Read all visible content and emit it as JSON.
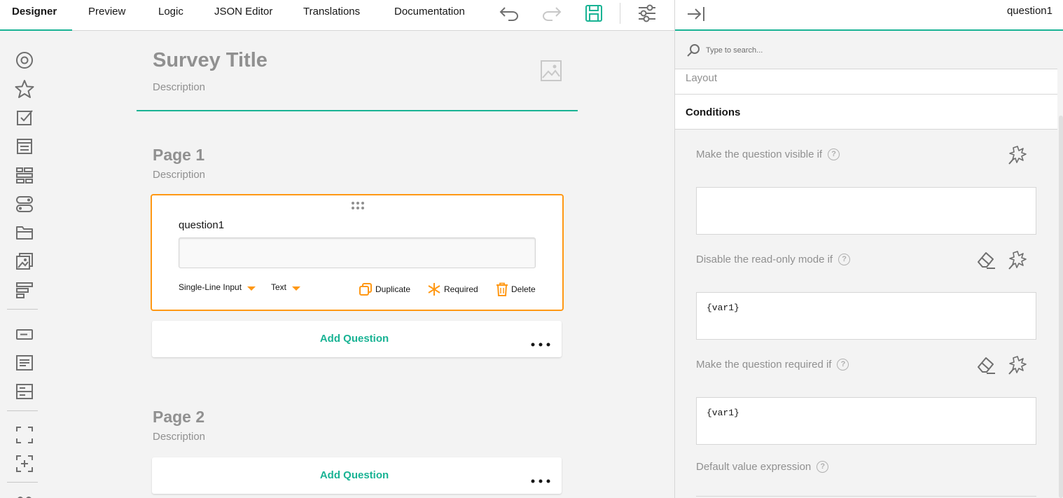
{
  "tabs": [
    {
      "label": "Designer"
    },
    {
      "label": "Preview"
    },
    {
      "label": "Logic"
    },
    {
      "label": "JSON Editor"
    },
    {
      "label": "Translations"
    },
    {
      "label": "Documentation"
    }
  ],
  "toolbar": {
    "undo_icon": "undo-icon",
    "redo_icon": "redo-icon",
    "save_icon": "save-icon",
    "settings_icon": "settings-icon"
  },
  "colors": {
    "accent": "#19b394",
    "selection": "#ff9814",
    "muted_text": "#909090"
  },
  "survey": {
    "title": "Survey Title",
    "description": "Description"
  },
  "pages": [
    {
      "title": "Page 1",
      "description": "Description"
    },
    {
      "title": "Page 2",
      "description": "Description"
    }
  ],
  "question": {
    "name": "question1",
    "type_label": "Single-Line Input",
    "input_type_label": "Text",
    "duplicate_label": "Duplicate",
    "required_label": "Required",
    "delete_label": "Delete"
  },
  "add_question_label": "Add Question",
  "panel": {
    "object_name": "question1",
    "search_placeholder": "Type to search...",
    "layout_label": "Layout",
    "conditions_label": "Conditions",
    "properties": [
      {
        "label": "Make the question visible if",
        "value": ""
      },
      {
        "label": "Disable the read-only mode if",
        "value": "{var1}"
      },
      {
        "label": "Make the question required if",
        "value": "{var1}"
      },
      {
        "label": "Default value expression",
        "value": ""
      }
    ]
  }
}
